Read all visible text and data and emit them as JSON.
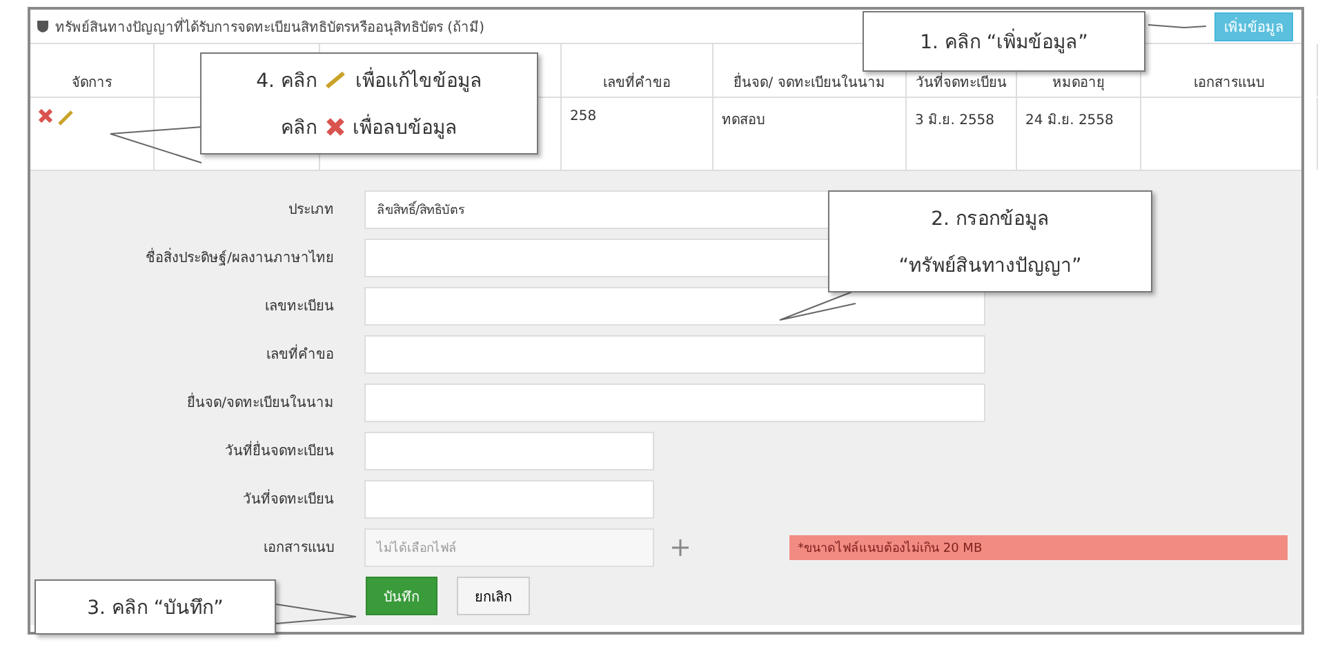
{
  "panel": {
    "title": "ทรัพย์สินทางปัญญาที่ได้รับการจดทะเบียนสิทธิบัตรหรืออนุสิทธิบัตร (ถ้ามี)",
    "add_button": "เพิ่มข้อมูล"
  },
  "table": {
    "columns": [
      {
        "label": "จัดการ"
      },
      {},
      {},
      {
        "label": "เลขที่คำขอ"
      },
      {
        "label": "ยื่นจด/ จดทะเบียนในนาม"
      },
      {
        "label": "วันที่จดทะเบียน"
      },
      {
        "label": "หมดอายุ"
      },
      {
        "label": "เอกสารแนบ"
      }
    ],
    "rows": [
      {
        "column_4": "258",
        "column_5": "ทดสอบ",
        "column_6": "3 มิ.ย. 2558",
        "column_7": "24 มิ.ย. 2558"
      }
    ]
  },
  "form": {
    "fields": [
      {
        "label": "ประเภท",
        "kind": "select",
        "value": "ลิขสิทธิ์/สิทธิบัตร"
      },
      {
        "label": "ชื่อสิ่งประดิษฐ์/ผลงานภาษาไทย",
        "kind": "text"
      },
      {
        "label": "เลขทะเบียน",
        "kind": "text"
      },
      {
        "label": "เลขที่คำขอ",
        "kind": "text"
      },
      {
        "label": "ยื่นจด/จดทะเบียนในนาม",
        "kind": "text"
      },
      {
        "label": "วันที่ยื่นจดทะเบียน",
        "kind": "date"
      },
      {
        "label": "วันที่จดทะเบียน",
        "kind": "date"
      },
      {
        "label": "เอกสารแนบ",
        "kind": "file",
        "placeholder": "ไม่ได้เลือกไฟล์",
        "note": "*ขนาดไฟล์แนบต้องไม่เกิน 20 MB"
      }
    ],
    "buttons": [
      {
        "label": "บันทึก",
        "kind": "primary"
      },
      {
        "label": "ยกเลิก",
        "kind": "default"
      }
    ]
  },
  "callouts": [
    {
      "kind": "add",
      "lines": [
        {
          "before": "1. คลิก “เพิ่มข้อมูล”"
        }
      ]
    },
    {
      "kind": "fill",
      "lines": [
        {
          "before": "2. กรอกข้อมูล"
        },
        {
          "before": "“ทรัพย์สินทางปัญญา”"
        }
      ]
    },
    {
      "kind": "save",
      "lines": [
        {
          "before": "3. คลิก “บันทึก”"
        }
      ]
    },
    {
      "kind": "edit",
      "lines": [
        {
          "kind": "edit",
          "before": "4. คลิก",
          "after": "เพื่อแก้ไขข้อมูล"
        },
        {
          "kind": "delete",
          "before": "คลิก",
          "after": "เพื่อลบข้อมูล"
        }
      ]
    }
  ]
}
